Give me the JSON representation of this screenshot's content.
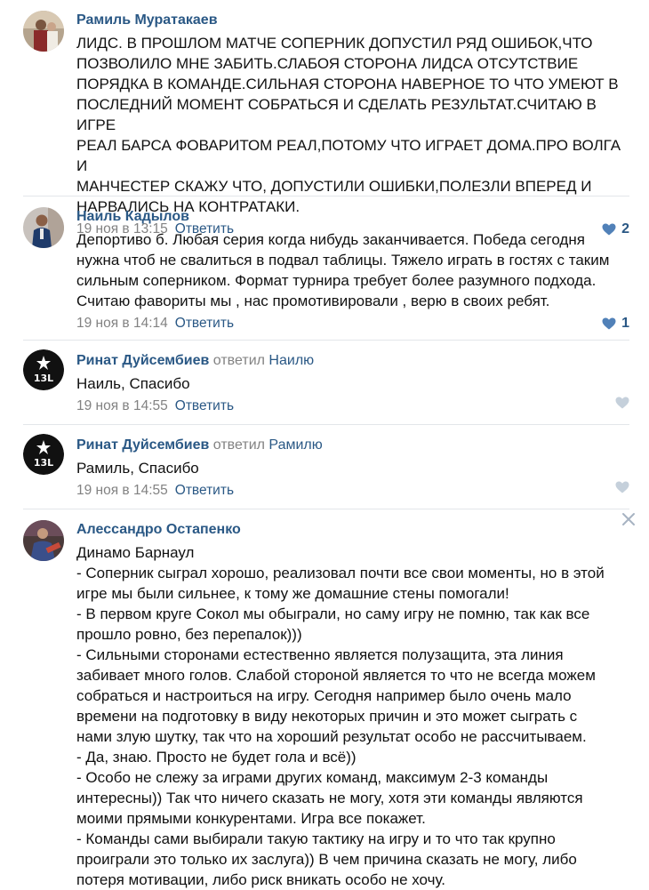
{
  "comments": [
    {
      "author": "Рамиль Муратакаев",
      "text": "ЛИДС. В ПРОШЛОМ МАТЧЕ СОПЕРНИК ДОПУСТИЛ РЯД ОШИБОК,ЧТО\nПОЗВОЛИЛО МНЕ ЗАБИТЬ.СЛАБОЯ СТОРОНА ЛИДСА ОТСУТСТВИЕ\nПОРЯДКА В КОМАНДЕ.СИЛЬНАЯ СТОРОНА НАВЕРНОЕ ТО ЧТО УМЕЮТ В\nПОСЛЕДНИЙ МОМЕНТ СОБРАТЬСЯ И СДЕЛАТЬ РЕЗУЛЬТАТ.СЧИТАЮ В ИГРЕ\nРЕАЛ БАРСА ФОВАРИТОМ РЕАЛ,ПОТОМУ ЧТО ИГРАЕТ ДОМА.ПРО ВОЛГА И\nМАНЧЕСТЕР СКАЖУ ЧТО, ДОПУСТИЛИ ОШИБКИ,ПОЛЕЗЛИ ВПЕРЕД И\nНАРВАЛИСЬ НА КОНТРАТАКИ.",
      "date": "19 ноя в 13:15",
      "reply": "Ответить",
      "likes": "2"
    },
    {
      "author": "Наиль Кадылов",
      "text": "Депортиво б. Любая серия когда нибудь заканчивается. Победа сегодня\nнужна чтоб не свалиться в подвал таблицы. Тяжело играть в гостях с таким\nсильным соперником. Формат турнира требует более разумного подхода.\nСчитаю фавориты мы , нас промотивировали , верю в своих ребят.",
      "date": "19 ноя в 14:14",
      "reply": "Ответить",
      "likes": "1"
    },
    {
      "author": "Ринат Дуйсембиев",
      "replied": "ответил",
      "replied_to": "Наилю",
      "text": "Наиль, Спасибо",
      "date": "19 ноя в 14:55",
      "reply": "Ответить",
      "avatar_label": "13L"
    },
    {
      "author": "Ринат Дуйсембиев",
      "replied": "ответил",
      "replied_to": "Рамилю",
      "text": "Рамиль, Спасибо",
      "date": "19 ноя в 14:55",
      "reply": "Ответить",
      "avatar_label": "13L"
    },
    {
      "author": "Алессандро Остапенко",
      "text": "Динамо Барнаул\n- Соперник сыграл хорошо, реализовал почти все свои моменты, но в этой\nигре мы были сильнее, к тому же домашние стены помогали!\n- В первом круге Сокол мы обыграли, но саму игру не помню, так как все\nпрошло ровно, без перепалок)))\n- Сильными сторонами естественно является полузащита, эта линия\nзабивает много голов. Слабой стороной является то что не всегда можем\nсобраться и настроиться на игру. Сегодня например было очень мало\nвремени на подготовку в виду некоторых причин и это может сыграть с\nнами злую шутку, так что на хороший результат особо не рассчитываем.\n- Да, знаю. Просто не будет гола и всё))\n- Особо не слежу за играми других команд, максимум 2-3 команды\nинтересны)) Так что ничего сказать не могу, хотя эти команды являются\nмоими прямыми конкурентами. Игра все покажет.\n- Команды сами выбирали такую тактику на игру и то что так крупно\nпроиграли это только их заслуга)) В чем причина сказать не могу, либо\nпотеря мотивации, либо риск вникать особо не хочу."
    }
  ],
  "colors": {
    "link": "#2a5885",
    "muted": "#828282",
    "heart_active": "#5181b8",
    "heart_inactive": "#c5d0db",
    "divider": "#e3e6ea"
  }
}
